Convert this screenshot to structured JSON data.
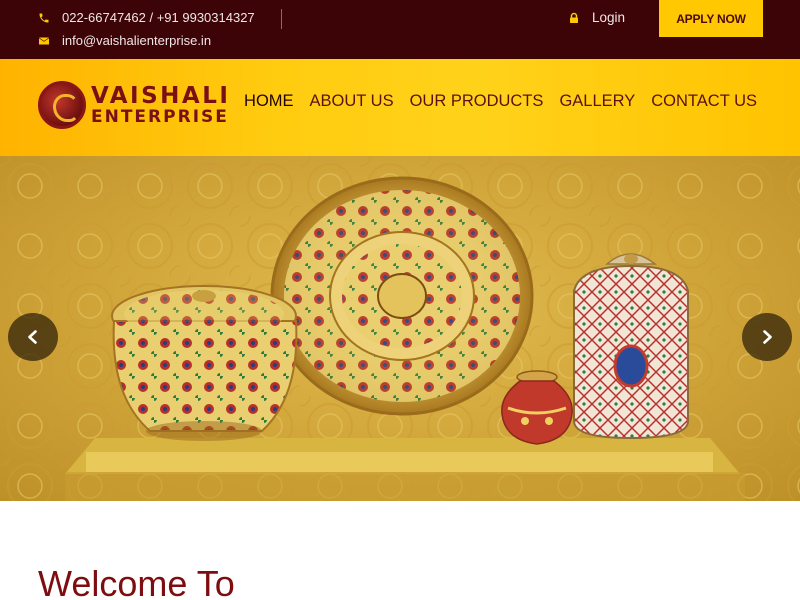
{
  "topbar": {
    "phone": "022-66747462 / +91 9930314327",
    "email": "info@vaishalienterprise.in",
    "login": "Login",
    "apply": "APPLY NOW",
    "phone_icon": "phone-icon",
    "email_icon": "envelope-icon",
    "login_icon": "lock-icon"
  },
  "header": {
    "logo_line1": "VAISHALI",
    "logo_line2": "ENTERPRISE",
    "nav": [
      "HOME",
      "ABOUT US",
      "OUR PRODUCTS",
      "GALLERY",
      "CONTACT US"
    ]
  },
  "hero": {
    "prev_icon": "chevron-left-icon",
    "next_icon": "chevron-right-icon"
  },
  "welcome": {
    "heading": "Welcome To"
  },
  "colors": {
    "topbar_bg": "#3d0408",
    "accent_yellow": "#ffc800",
    "brand_maroon": "#7e0d10"
  }
}
